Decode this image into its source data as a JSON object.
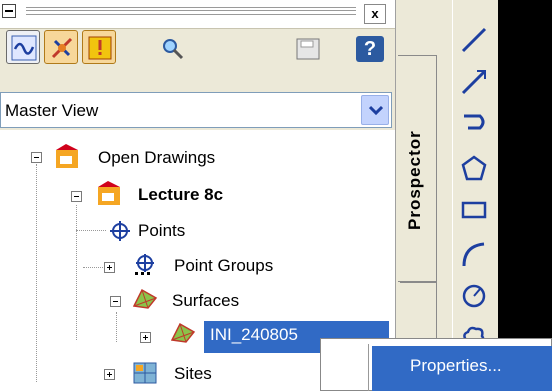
{
  "panel": {
    "close_label": "x"
  },
  "toolbar": {
    "buttons": [
      {
        "icon": "settings-wave-icon"
      },
      {
        "icon": "pick-tool-icon"
      },
      {
        "icon": "warning-icon"
      },
      {
        "icon": "search-icon"
      },
      {
        "icon": "save-icon"
      },
      {
        "icon": "help-icon",
        "label": "?"
      }
    ]
  },
  "view_select": {
    "value": "Master View"
  },
  "tree": {
    "items": [
      {
        "label": "Open Drawings"
      },
      {
        "label": "Lecture 8c"
      },
      {
        "label": "Points"
      },
      {
        "label": "Point Groups"
      },
      {
        "label": "Surfaces"
      },
      {
        "label": "INI_240805"
      },
      {
        "label": "Sites"
      }
    ]
  },
  "tab": {
    "label": "Prospector"
  },
  "context_menu": {
    "items": [
      {
        "label": "Properties..."
      }
    ]
  },
  "colors": {
    "selection": "#316ac5",
    "panel_bg": "#ece9d8",
    "tree_bg": "#ffffff"
  }
}
